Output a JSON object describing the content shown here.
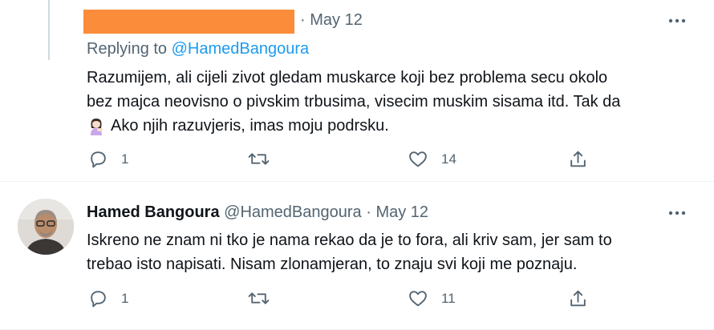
{
  "tweets": [
    {
      "redacted_color": "#fb8c3a",
      "date_sep": "·",
      "date": "May 12",
      "replying_prefix": "Replying to",
      "replying_handle": "@HamedBangoura",
      "text_line1": "Razumijem, ali cijeli zivot gledam muskarce koji bez problema secu okolo",
      "text_line2": "bez majca neovisno o pivskim trbusima, visecim muskim sisama itd. Tak da",
      "text_line3": "Ako njih razuvjeris, imas moju podrsku.",
      "emoji": "woman-tipping-hand",
      "replies": "1",
      "retweets": "",
      "likes": "14"
    },
    {
      "author_name": "Hamed Bangoura",
      "author_handle": "@HamedBangoura",
      "date_sep": "·",
      "date": "May 12",
      "text_line1": "Iskreno ne znam ni tko je nama rekao da je to fora, ali kriv sam, jer sam to",
      "text_line2": "trebao isto napisati. Nisam zlonamjeran, to znaju svi koji me poznaju.",
      "replies": "1",
      "retweets": "",
      "likes": "11"
    }
  ],
  "icons": [
    "reply-icon",
    "retweet-icon",
    "like-icon",
    "share-icon",
    "more-icon"
  ],
  "colors": {
    "accent": "#1d9bf0",
    "secondary_text": "#536471",
    "text": "#0f1419"
  }
}
